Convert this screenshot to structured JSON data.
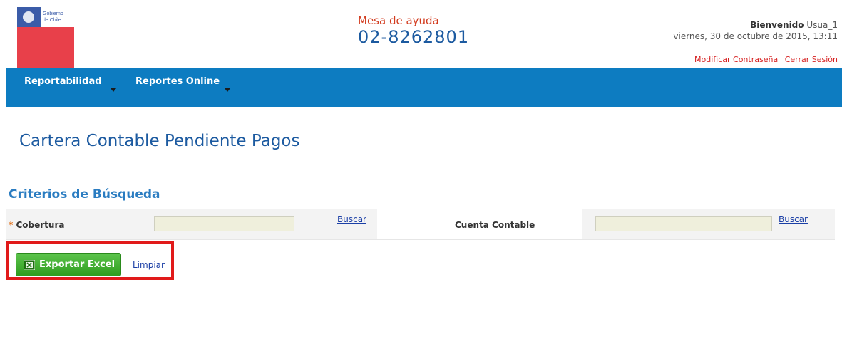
{
  "header": {
    "logo_text_line1": "Gobierno",
    "logo_text_line2": "de Chile",
    "help_label": "Mesa de ayuda",
    "help_phone": "02-8262801",
    "welcome_label": "Bienvenido",
    "user_name": "Usua_1",
    "datetime": "viernes, 30 de octubre de 2015, 13:11",
    "change_password_link": "Modificar Contraseña",
    "logout_link": "Cerrar Sesión"
  },
  "nav": {
    "items": [
      {
        "label": "Reportabilidad"
      },
      {
        "label": "Reportes Online"
      }
    ]
  },
  "page": {
    "title": "Cartera Contable Pendiente Pagos",
    "criteria_title": "Criterios de Búsqueda"
  },
  "criteria": {
    "required_mark": "*",
    "cobertura_label": "Cobertura",
    "cobertura_value": "",
    "cobertura_search_link": "Buscar",
    "cuenta_label": "Cuenta Contable",
    "cuenta_value": "",
    "cuenta_search_link": "Buscar"
  },
  "actions": {
    "export_label": "Exportar Excel",
    "clear_label": "Limpiar"
  },
  "colors": {
    "nav_blue": "#0d7cc1",
    "title_blue": "#1c5aa0",
    "help_red": "#d23b1e",
    "export_green": "#3aa82a",
    "highlight_red": "#e11a1a"
  }
}
